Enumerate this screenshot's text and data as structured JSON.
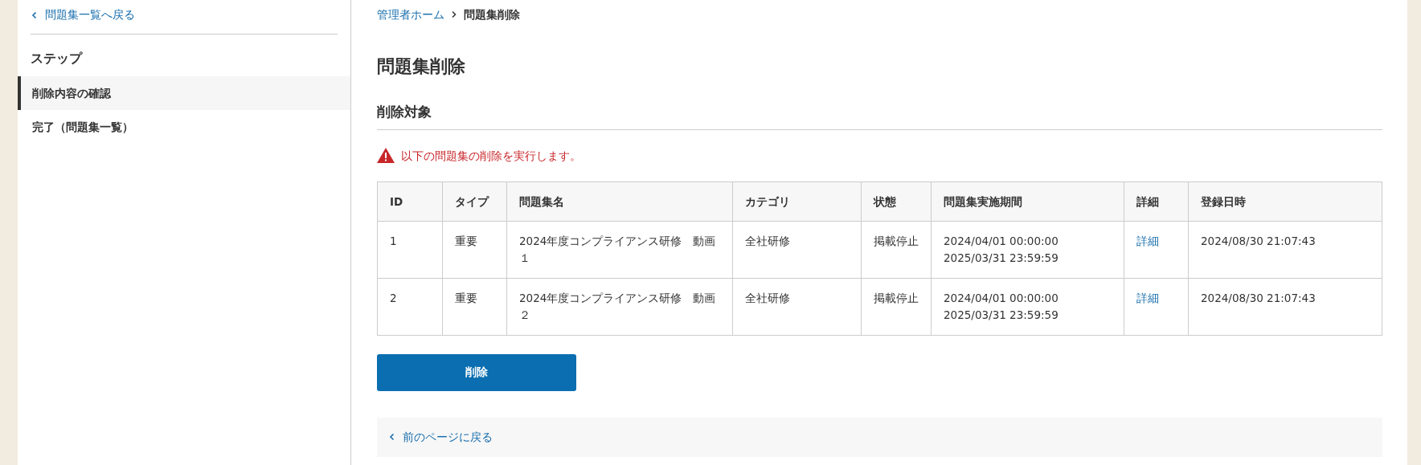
{
  "sidebar": {
    "back_link": "問題集一覧へ戻る",
    "steps_title": "ステップ",
    "steps": [
      {
        "label": "削除内容の確認",
        "selected": true
      },
      {
        "label": "完了（問題集一覧）",
        "selected": false
      }
    ]
  },
  "breadcrumb": [
    {
      "label": "管理者ホーム",
      "kind": "link"
    },
    {
      "label": "問題集削除",
      "kind": "current"
    }
  ],
  "title": "問題集削除",
  "section_title": "削除対象",
  "alert": "以下の問題集の削除を実行します。",
  "table": {
    "columns": [
      "ID",
      "タイプ",
      "問題集名",
      "カテゴリ",
      "状態",
      "問題集実施期間",
      "詳細",
      "登録日時"
    ],
    "rows": [
      {
        "id": "1",
        "type": "重要",
        "name": "2024年度コンプライアンス研修　動画１",
        "category": "全社研修",
        "status": "掲載停止",
        "period_start": "2024/04/01 00:00:00",
        "period_end": "2025/03/31 23:59:59",
        "detail": "詳細",
        "registered": "2024/08/30 21:07:43"
      },
      {
        "id": "2",
        "type": "重要",
        "name": "2024年度コンプライアンス研修　動画２",
        "category": "全社研修",
        "status": "掲載停止",
        "period_start": "2024/04/01 00:00:00",
        "period_end": "2025/03/31 23:59:59",
        "detail": "詳細",
        "registered": "2024/08/30 21:07:43"
      }
    ]
  },
  "delete_button": "削除",
  "back_page_link": "前のページに戻る"
}
